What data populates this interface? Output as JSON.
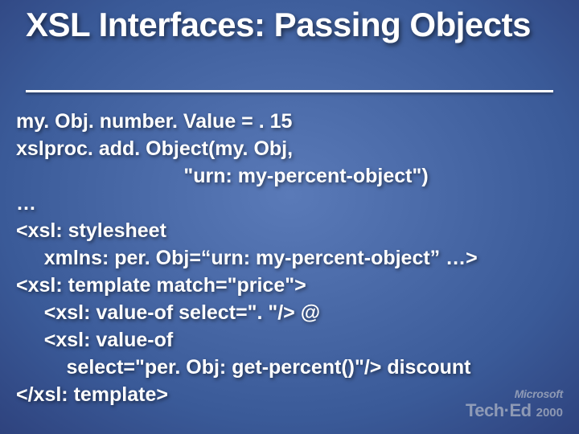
{
  "title": "XSL Interfaces: Passing Objects",
  "code_lines": [
    "my. Obj. number. Value = . 15",
    "xslproc. add. Object(my. Obj,",
    "                              \"urn: my-percent-object\")",
    "…",
    "<xsl: stylesheet",
    "     xmlns: per. Obj=“urn: my-percent-object” …>",
    "<xsl: template match=\"price\">",
    "     <xsl: value-of select=\". \"/> @",
    "     <xsl: value-of",
    "         select=\"per. Obj: get-percent()\"/> discount",
    "</xsl: template>"
  ],
  "logo": {
    "company": "Microsoft",
    "event": "Tech·Ed",
    "year": "2000"
  }
}
